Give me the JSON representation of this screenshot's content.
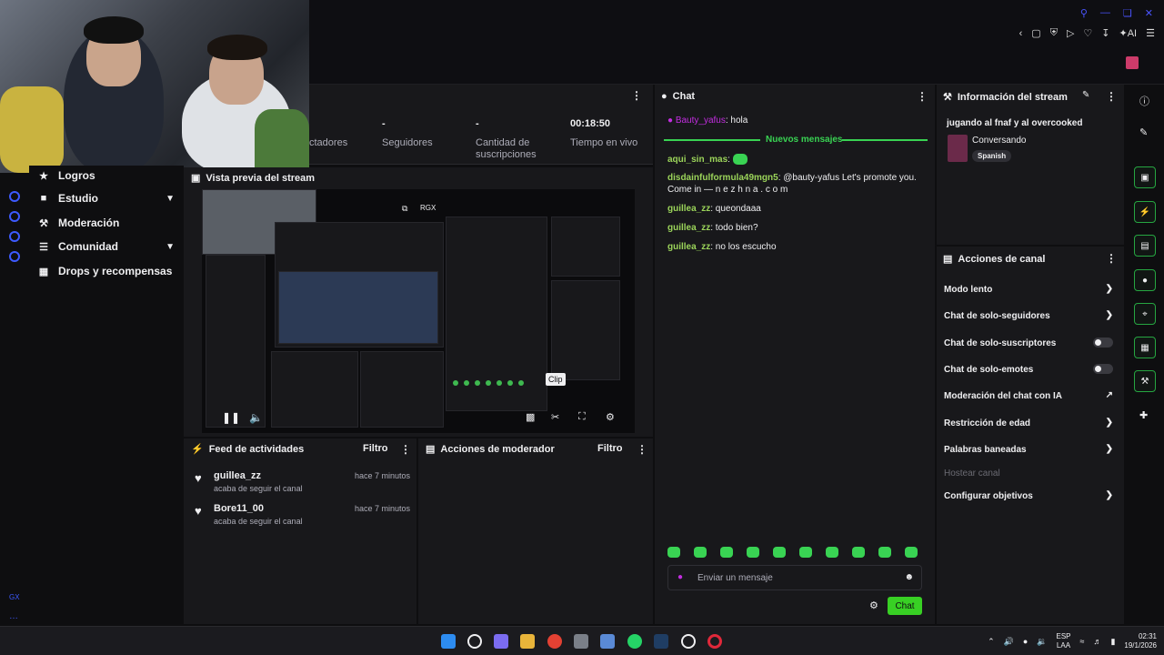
{
  "stats": [
    {
      "value": "",
      "label": "ctadores"
    },
    {
      "value": "-",
      "label": "Seguidores"
    },
    {
      "value": "-",
      "label": "Cantidad de suscripciones"
    },
    {
      "value": "00:18:50",
      "label": "Tiempo en vivo"
    }
  ],
  "sidebar": {
    "items": [
      {
        "label": "Logros",
        "icon": "trophy-icon"
      },
      {
        "label": "Estudio",
        "icon": "studio-icon"
      },
      {
        "label": "Moderación",
        "icon": "wrench-icon"
      },
      {
        "label": "Comunidad",
        "icon": "community-icon"
      },
      {
        "label": "Drops y recompensas",
        "icon": "gift-icon"
      }
    ]
  },
  "preview": {
    "title": "Vista previa del stream",
    "rgx": "RGX",
    "clip_tooltip": "Clip"
  },
  "activity": {
    "title": "Feed de actividades",
    "filter": "Filtro",
    "items": [
      {
        "name": "guillea_zz",
        "sub": "acaba de seguir el canal",
        "time": "hace 7 minutos"
      },
      {
        "name": "Bore11_00",
        "sub": "acaba de seguir el canal",
        "time": "hace 7 minutos"
      }
    ]
  },
  "modactions": {
    "title": "Acciones de moderador",
    "filter": "Filtro"
  },
  "chat": {
    "title": "Chat",
    "pinned_user": "Bauty_yafus",
    "pinned_msg": ": hola",
    "new_messages": "Nuevos mensajes",
    "messages": [
      {
        "user": "aqui_sin_mas",
        "text": ":"
      },
      {
        "user": "disdainfulformula49mgn5",
        "text": ": @bauty-yafus Let's promote you. Come in — n e z h n a . c o m"
      },
      {
        "user": "guillea_zz",
        "text": ": queondaaa"
      },
      {
        "user": "guillea_zz",
        "text": ": todo bien?"
      },
      {
        "user": "guillea_zz",
        "text": ": no los escucho"
      }
    ],
    "placeholder": "Enviar un mensaje",
    "send": "Chat"
  },
  "info": {
    "title": "Información del stream",
    "stream_title": "jugando al fnaf y al overcooked",
    "category": "Conversando",
    "tag": "Spanish"
  },
  "channel_actions": {
    "title": "Acciones de canal",
    "items": [
      {
        "label": "Modo lento",
        "control": "chevron"
      },
      {
        "label": "Chat de solo-seguidores",
        "control": "chevron"
      },
      {
        "label": "Chat de solo-suscriptores",
        "control": "toggle"
      },
      {
        "label": "Chat de solo-emotes",
        "control": "toggle"
      },
      {
        "label": "Moderación del chat con IA",
        "control": "external"
      },
      {
        "label": "Restricción de edad",
        "control": "chevron"
      },
      {
        "label": "Palabras baneadas",
        "control": "chevron"
      },
      {
        "label": "Hostear canal",
        "control": "none"
      },
      {
        "label": "Configurar objetivos",
        "control": "chevron"
      }
    ]
  },
  "taskbar": {
    "lang_top": "ESP",
    "lang_bottom": "LAA",
    "time": "02:31",
    "date": "19/1/2026"
  },
  "colors": {
    "accent_green": "#39d353",
    "chat_button": "#38d024",
    "pinned_user": "#c32de0",
    "rail_blue": "#3d5afe"
  }
}
